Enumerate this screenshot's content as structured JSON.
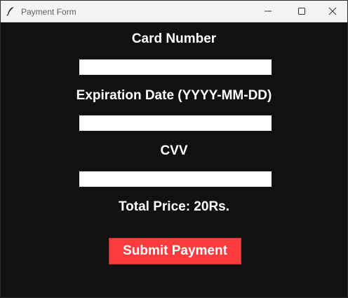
{
  "window": {
    "title": "Payment Form",
    "icons": {
      "app": "feather-icon",
      "minimize": "minimize-icon",
      "maximize": "maximize-icon",
      "close": "close-icon"
    }
  },
  "form": {
    "card_number_label": "Card Number",
    "card_number_value": "",
    "expiration_label": "Expiration Date (YYYY-MM-DD)",
    "expiration_value": "",
    "cvv_label": "CVV",
    "cvv_value": "",
    "total_price_text": "Total Price: 20Rs.",
    "submit_label": "Submit Payment"
  },
  "colors": {
    "background": "#111111",
    "text": "#ffffff",
    "submit_bg": "#fc3b3f",
    "field_bg": "#ffffff",
    "titlebar_bg": "#f3f3f3"
  }
}
